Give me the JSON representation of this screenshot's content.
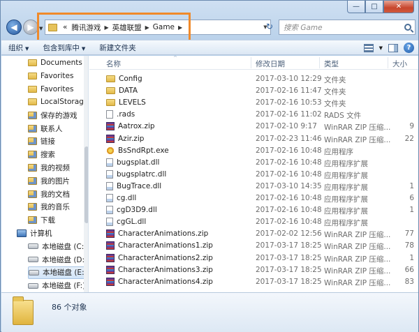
{
  "window": {
    "minimize_glyph": "—",
    "maximize_glyph": "□",
    "close_glyph": "✕"
  },
  "nav_buttons": {
    "back_glyph": "◀",
    "forward_glyph": "▶",
    "history_glyph": "▼"
  },
  "address": {
    "lead_glyph": "«",
    "crumbs": [
      "腾讯游戏",
      "英雄联盟",
      "Game"
    ],
    "separator_glyph": "▶",
    "dropdown_glyph": "▼",
    "refresh_glyph": "↻"
  },
  "search": {
    "placeholder": "搜索 Game"
  },
  "toolbar": {
    "organize": "组织",
    "include_in_library": "包含到库中",
    "new_folder": "新建文件夹",
    "dropdown_glyph": "▼",
    "help_glyph": "?"
  },
  "sidebar": {
    "items": [
      {
        "label": "Documents",
        "icon": "folder-icon"
      },
      {
        "label": "Favorites",
        "icon": "folder-icon"
      },
      {
        "label": "Favorites",
        "icon": "folder-icon"
      },
      {
        "label": "LocalStorage",
        "icon": "folder-icon"
      },
      {
        "label": "保存的游戏",
        "icon": "saved-games-icon"
      },
      {
        "label": "联系人",
        "icon": "contacts-icon"
      },
      {
        "label": "链接",
        "icon": "links-icon"
      },
      {
        "label": "搜索",
        "icon": "search-folder-icon"
      },
      {
        "label": "我的视频",
        "icon": "videos-icon"
      },
      {
        "label": "我的图片",
        "icon": "pictures-icon"
      },
      {
        "label": "我的文档",
        "icon": "documents-icon"
      },
      {
        "label": "我的音乐",
        "icon": "music-icon"
      },
      {
        "label": "下载",
        "icon": "downloads-icon"
      },
      {
        "label": "计算机",
        "icon": "computer-icon"
      },
      {
        "label": "本地磁盘 (C:)",
        "icon": "drive-icon"
      },
      {
        "label": "本地磁盘 (D:)",
        "icon": "drive-icon"
      },
      {
        "label": "本地磁盘 (E:)",
        "icon": "drive-icon"
      },
      {
        "label": "本地磁盘 (F:)",
        "icon": "drive-icon"
      }
    ]
  },
  "columns": {
    "name": "名称",
    "date": "修改日期",
    "type": "类型",
    "size": "大小",
    "sort_glyph": "^"
  },
  "files": [
    {
      "name": "Config",
      "date": "2017-03-10 12:29",
      "type": "文件夹",
      "size": "",
      "icon": "folder-icon"
    },
    {
      "name": "DATA",
      "date": "2017-02-16 11:47",
      "type": "文件夹",
      "size": "",
      "icon": "folder-icon"
    },
    {
      "name": "LEVELS",
      "date": "2017-02-16 10:53",
      "type": "文件夹",
      "size": "",
      "icon": "folder-icon"
    },
    {
      "name": ".rads",
      "date": "2017-02-16 11:02",
      "type": "RADS 文件",
      "size": "",
      "icon": "file-icon"
    },
    {
      "name": "Aatrox.zip",
      "date": "2017-02-10 9:17",
      "type": "WinRAR ZIP 压缩...",
      "size": "9",
      "icon": "zip-icon"
    },
    {
      "name": "Azir.zip",
      "date": "2017-02-23 11:46",
      "type": "WinRAR ZIP 压缩...",
      "size": "22",
      "icon": "zip-icon"
    },
    {
      "name": "BsSndRpt.exe",
      "date": "2017-02-16 10:48",
      "type": "应用程序",
      "size": "",
      "icon": "exe-icon"
    },
    {
      "name": "bugsplat.dll",
      "date": "2017-02-16 10:48",
      "type": "应用程序扩展",
      "size": "",
      "icon": "dll-icon"
    },
    {
      "name": "bugsplatrc.dll",
      "date": "2017-02-16 10:48",
      "type": "应用程序扩展",
      "size": "",
      "icon": "dll-icon"
    },
    {
      "name": "BugTrace.dll",
      "date": "2017-03-10 14:35",
      "type": "应用程序扩展",
      "size": "1",
      "icon": "dll-icon"
    },
    {
      "name": "cg.dll",
      "date": "2017-02-16 10:48",
      "type": "应用程序扩展",
      "size": "6",
      "icon": "dll-icon"
    },
    {
      "name": "cgD3D9.dll",
      "date": "2017-02-16 10:48",
      "type": "应用程序扩展",
      "size": "1",
      "icon": "dll-icon"
    },
    {
      "name": "cgGL.dll",
      "date": "2017-02-16 10:48",
      "type": "应用程序扩展",
      "size": "",
      "icon": "dll-icon"
    },
    {
      "name": "CharacterAnimations.zip",
      "date": "2017-02-02 12:56",
      "type": "WinRAR ZIP 压缩...",
      "size": "77",
      "icon": "zip-icon"
    },
    {
      "name": "CharacterAnimations1.zip",
      "date": "2017-03-17 18:25",
      "type": "WinRAR ZIP 压缩...",
      "size": "78",
      "icon": "zip-icon"
    },
    {
      "name": "CharacterAnimations2.zip",
      "date": "2017-03-17 18:25",
      "type": "WinRAR ZIP 压缩...",
      "size": "1",
      "icon": "zip-icon"
    },
    {
      "name": "CharacterAnimations3.zip",
      "date": "2017-03-17 18:25",
      "type": "WinRAR ZIP 压缩...",
      "size": "66",
      "icon": "zip-icon"
    },
    {
      "name": "CharacterAnimations4.zip",
      "date": "2017-03-17 18:25",
      "type": "WinRAR ZIP 压缩...",
      "size": "83",
      "icon": "zip-icon"
    }
  ],
  "status": {
    "count": "86 个对象"
  },
  "colors": {
    "highlight": "#f08a2b",
    "window": "#b9d1ea"
  }
}
